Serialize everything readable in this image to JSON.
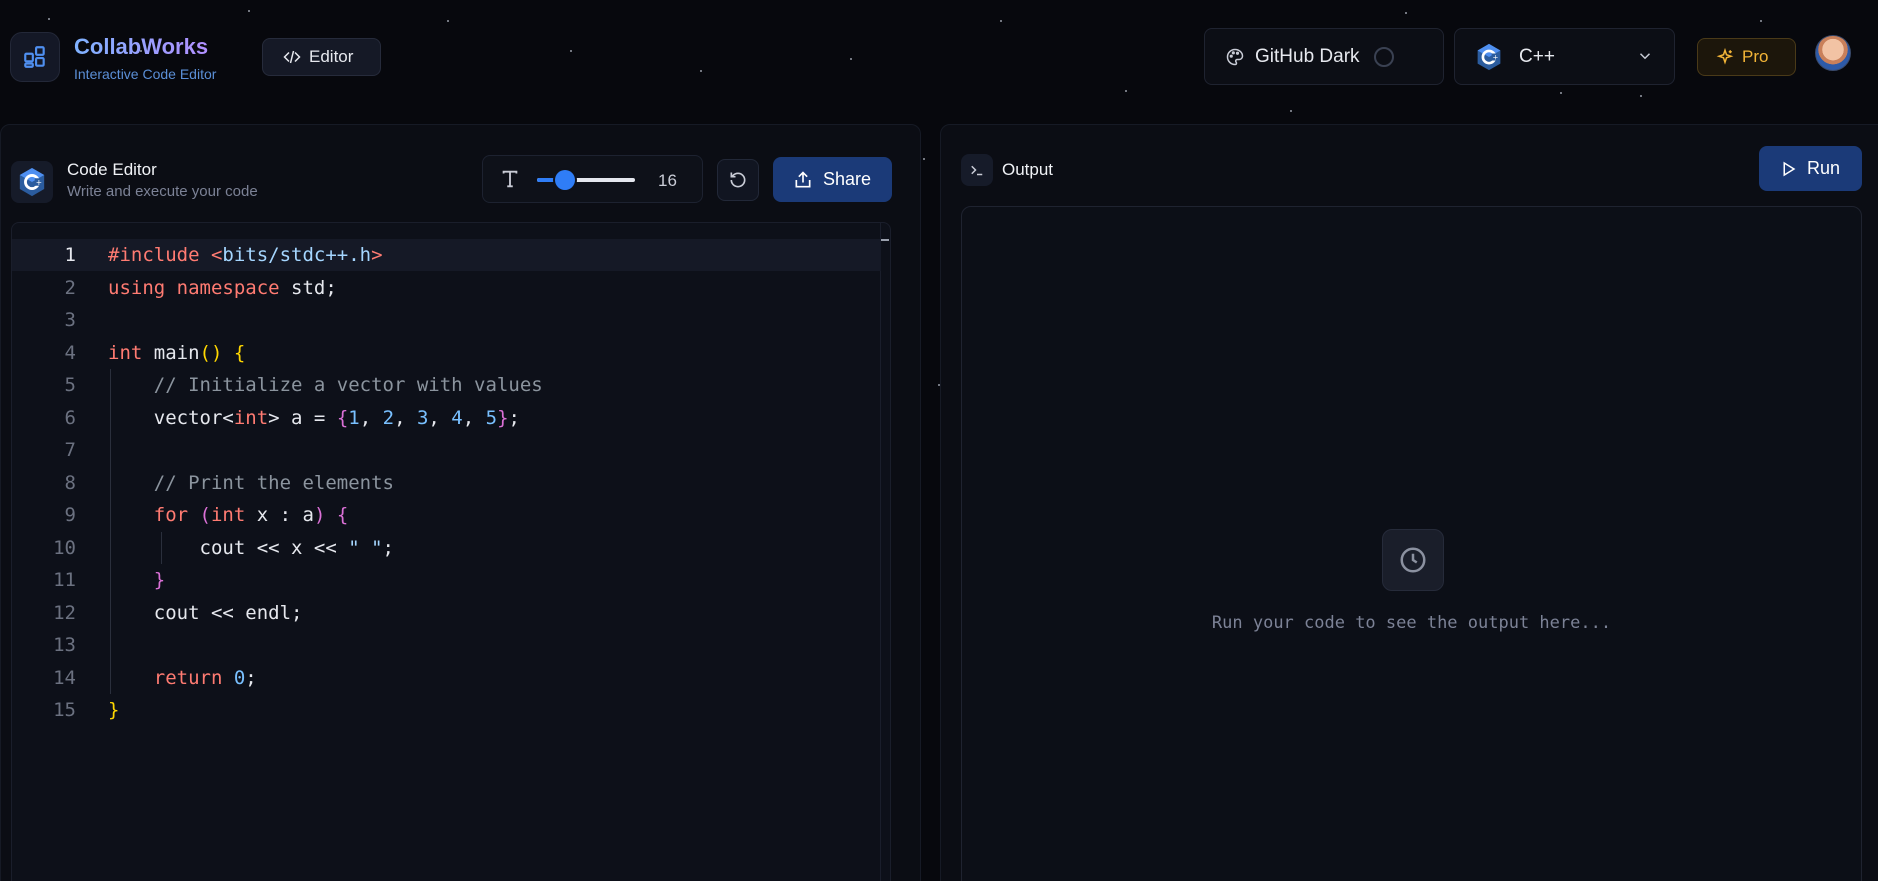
{
  "app": {
    "name": "CollabWorks",
    "subtitle": "Interactive Code Editor"
  },
  "header": {
    "editor_tab_label": "Editor",
    "theme_label": "GitHub Dark",
    "language_label": "C++",
    "pro_label": "Pro"
  },
  "editor_panel": {
    "title": "Code Editor",
    "subtitle": "Write and execute your code",
    "font_size": "16",
    "font_size_slider_fraction": 0.29,
    "share_label": "Share",
    "active_line": 1,
    "lines": [
      {
        "n": "1",
        "tokens": [
          [
            "inc",
            "#include "
          ],
          [
            "inc",
            "<"
          ],
          [
            "hdr",
            "bits/stdc++.h"
          ],
          [
            "inc",
            ">"
          ]
        ]
      },
      {
        "n": "2",
        "tokens": [
          [
            "kw",
            "using "
          ],
          [
            "kw",
            "namespace "
          ],
          [
            "pun",
            "std;"
          ]
        ]
      },
      {
        "n": "3",
        "tokens": []
      },
      {
        "n": "4",
        "tokens": [
          [
            "kw",
            "int "
          ],
          [
            "pun",
            "main"
          ],
          [
            "br1",
            "() {"
          ]
        ]
      },
      {
        "n": "5",
        "tokens": [
          [
            "pun",
            "    "
          ],
          [
            "cm",
            "// Initialize a vector with values"
          ]
        ]
      },
      {
        "n": "6",
        "tokens": [
          [
            "pun",
            "    vector<"
          ],
          [
            "kw",
            "int"
          ],
          [
            "pun",
            "> a = "
          ],
          [
            "br2",
            "{"
          ],
          [
            "num",
            "1"
          ],
          [
            "pun",
            ", "
          ],
          [
            "num",
            "2"
          ],
          [
            "pun",
            ", "
          ],
          [
            "num",
            "3"
          ],
          [
            "pun",
            ", "
          ],
          [
            "num",
            "4"
          ],
          [
            "pun",
            ", "
          ],
          [
            "num",
            "5"
          ],
          [
            "br2",
            "}"
          ],
          [
            "pun",
            ";"
          ]
        ]
      },
      {
        "n": "7",
        "tokens": []
      },
      {
        "n": "8",
        "tokens": [
          [
            "pun",
            "    "
          ],
          [
            "cm",
            "// Print the elements"
          ]
        ]
      },
      {
        "n": "9",
        "tokens": [
          [
            "pun",
            "    "
          ],
          [
            "kw",
            "for "
          ],
          [
            "br2",
            "("
          ],
          [
            "kw",
            "int "
          ],
          [
            "pun",
            "x : a"
          ],
          [
            "br2",
            ")"
          ],
          [
            "pun",
            " "
          ],
          [
            "br2",
            "{"
          ]
        ]
      },
      {
        "n": "10",
        "tokens": [
          [
            "pun",
            "        cout << x << "
          ],
          [
            "str",
            "\" \""
          ],
          [
            "pun",
            ";"
          ]
        ]
      },
      {
        "n": "11",
        "tokens": [
          [
            "pun",
            "    "
          ],
          [
            "br2",
            "}"
          ]
        ]
      },
      {
        "n": "12",
        "tokens": [
          [
            "pun",
            "    cout << endl;"
          ]
        ]
      },
      {
        "n": "13",
        "tokens": []
      },
      {
        "n": "14",
        "tokens": [
          [
            "pun",
            "    "
          ],
          [
            "kw",
            "return "
          ],
          [
            "num",
            "0"
          ],
          [
            "pun",
            ";"
          ]
        ]
      },
      {
        "n": "15",
        "tokens": [
          [
            "br1",
            "}"
          ]
        ]
      }
    ]
  },
  "output_panel": {
    "title": "Output",
    "run_label": "Run",
    "placeholder": "Run your code to see the output here..."
  },
  "colors": {
    "accent": "#2f7df6",
    "button_bg": "#1b3a78",
    "pro": "#f2b437",
    "background": "#07080d"
  },
  "icons": [
    "grid-logo-icon",
    "code-icon",
    "palette-icon",
    "cpp-logo-icon",
    "chevron-down-icon",
    "sparkle-icon",
    "text-size-icon",
    "reset-icon",
    "share-icon",
    "terminal-icon",
    "play-icon",
    "clock-icon"
  ]
}
